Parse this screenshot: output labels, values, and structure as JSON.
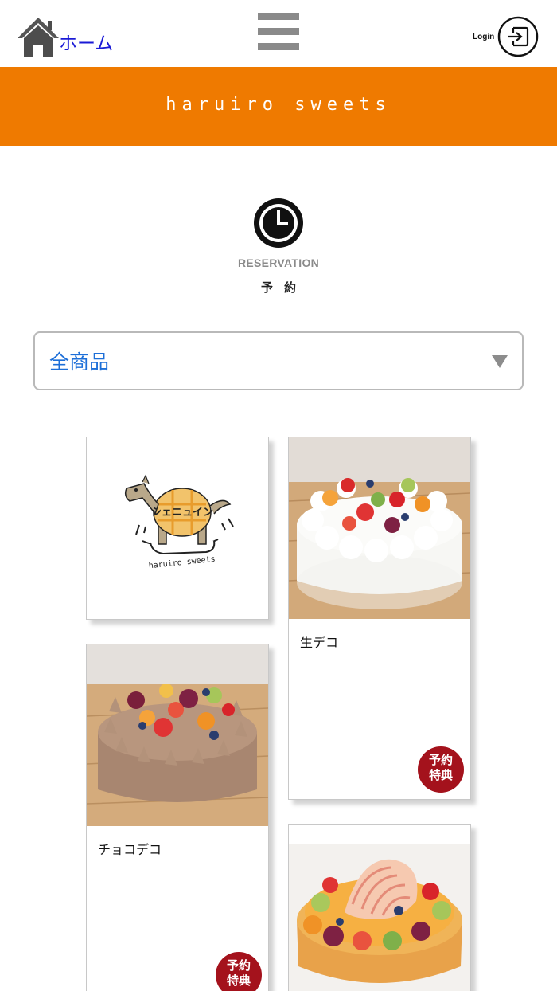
{
  "nav": {
    "home_label": "ホーム",
    "login_label": "Login",
    "home_icon": "home-icon",
    "menu_icon": "hamburger-menu-icon",
    "login_icon": "login-icon"
  },
  "banner": {
    "title": "haruiro sweets",
    "color": "#ef7a00"
  },
  "reservation": {
    "icon": "clock-icon",
    "label_en": "RESERVATION",
    "label_ja": "予約"
  },
  "filter": {
    "selected": "全商品"
  },
  "logo_card": {
    "logo_text": "シェニュイン",
    "logo_subtext": "haruiro sweets"
  },
  "products": [
    {
      "name": "生デコ",
      "badge_line1": "予約",
      "badge_line2": "特典"
    },
    {
      "name": "チョコデコ",
      "badge_line1": "予約",
      "badge_line2": "特典"
    },
    {
      "name": ""
    }
  ],
  "colors": {
    "accent_orange": "#ef7a00",
    "badge_red": "#a4121c",
    "link_blue": "#1a1ad6",
    "select_text_blue": "#1d6fd8"
  }
}
